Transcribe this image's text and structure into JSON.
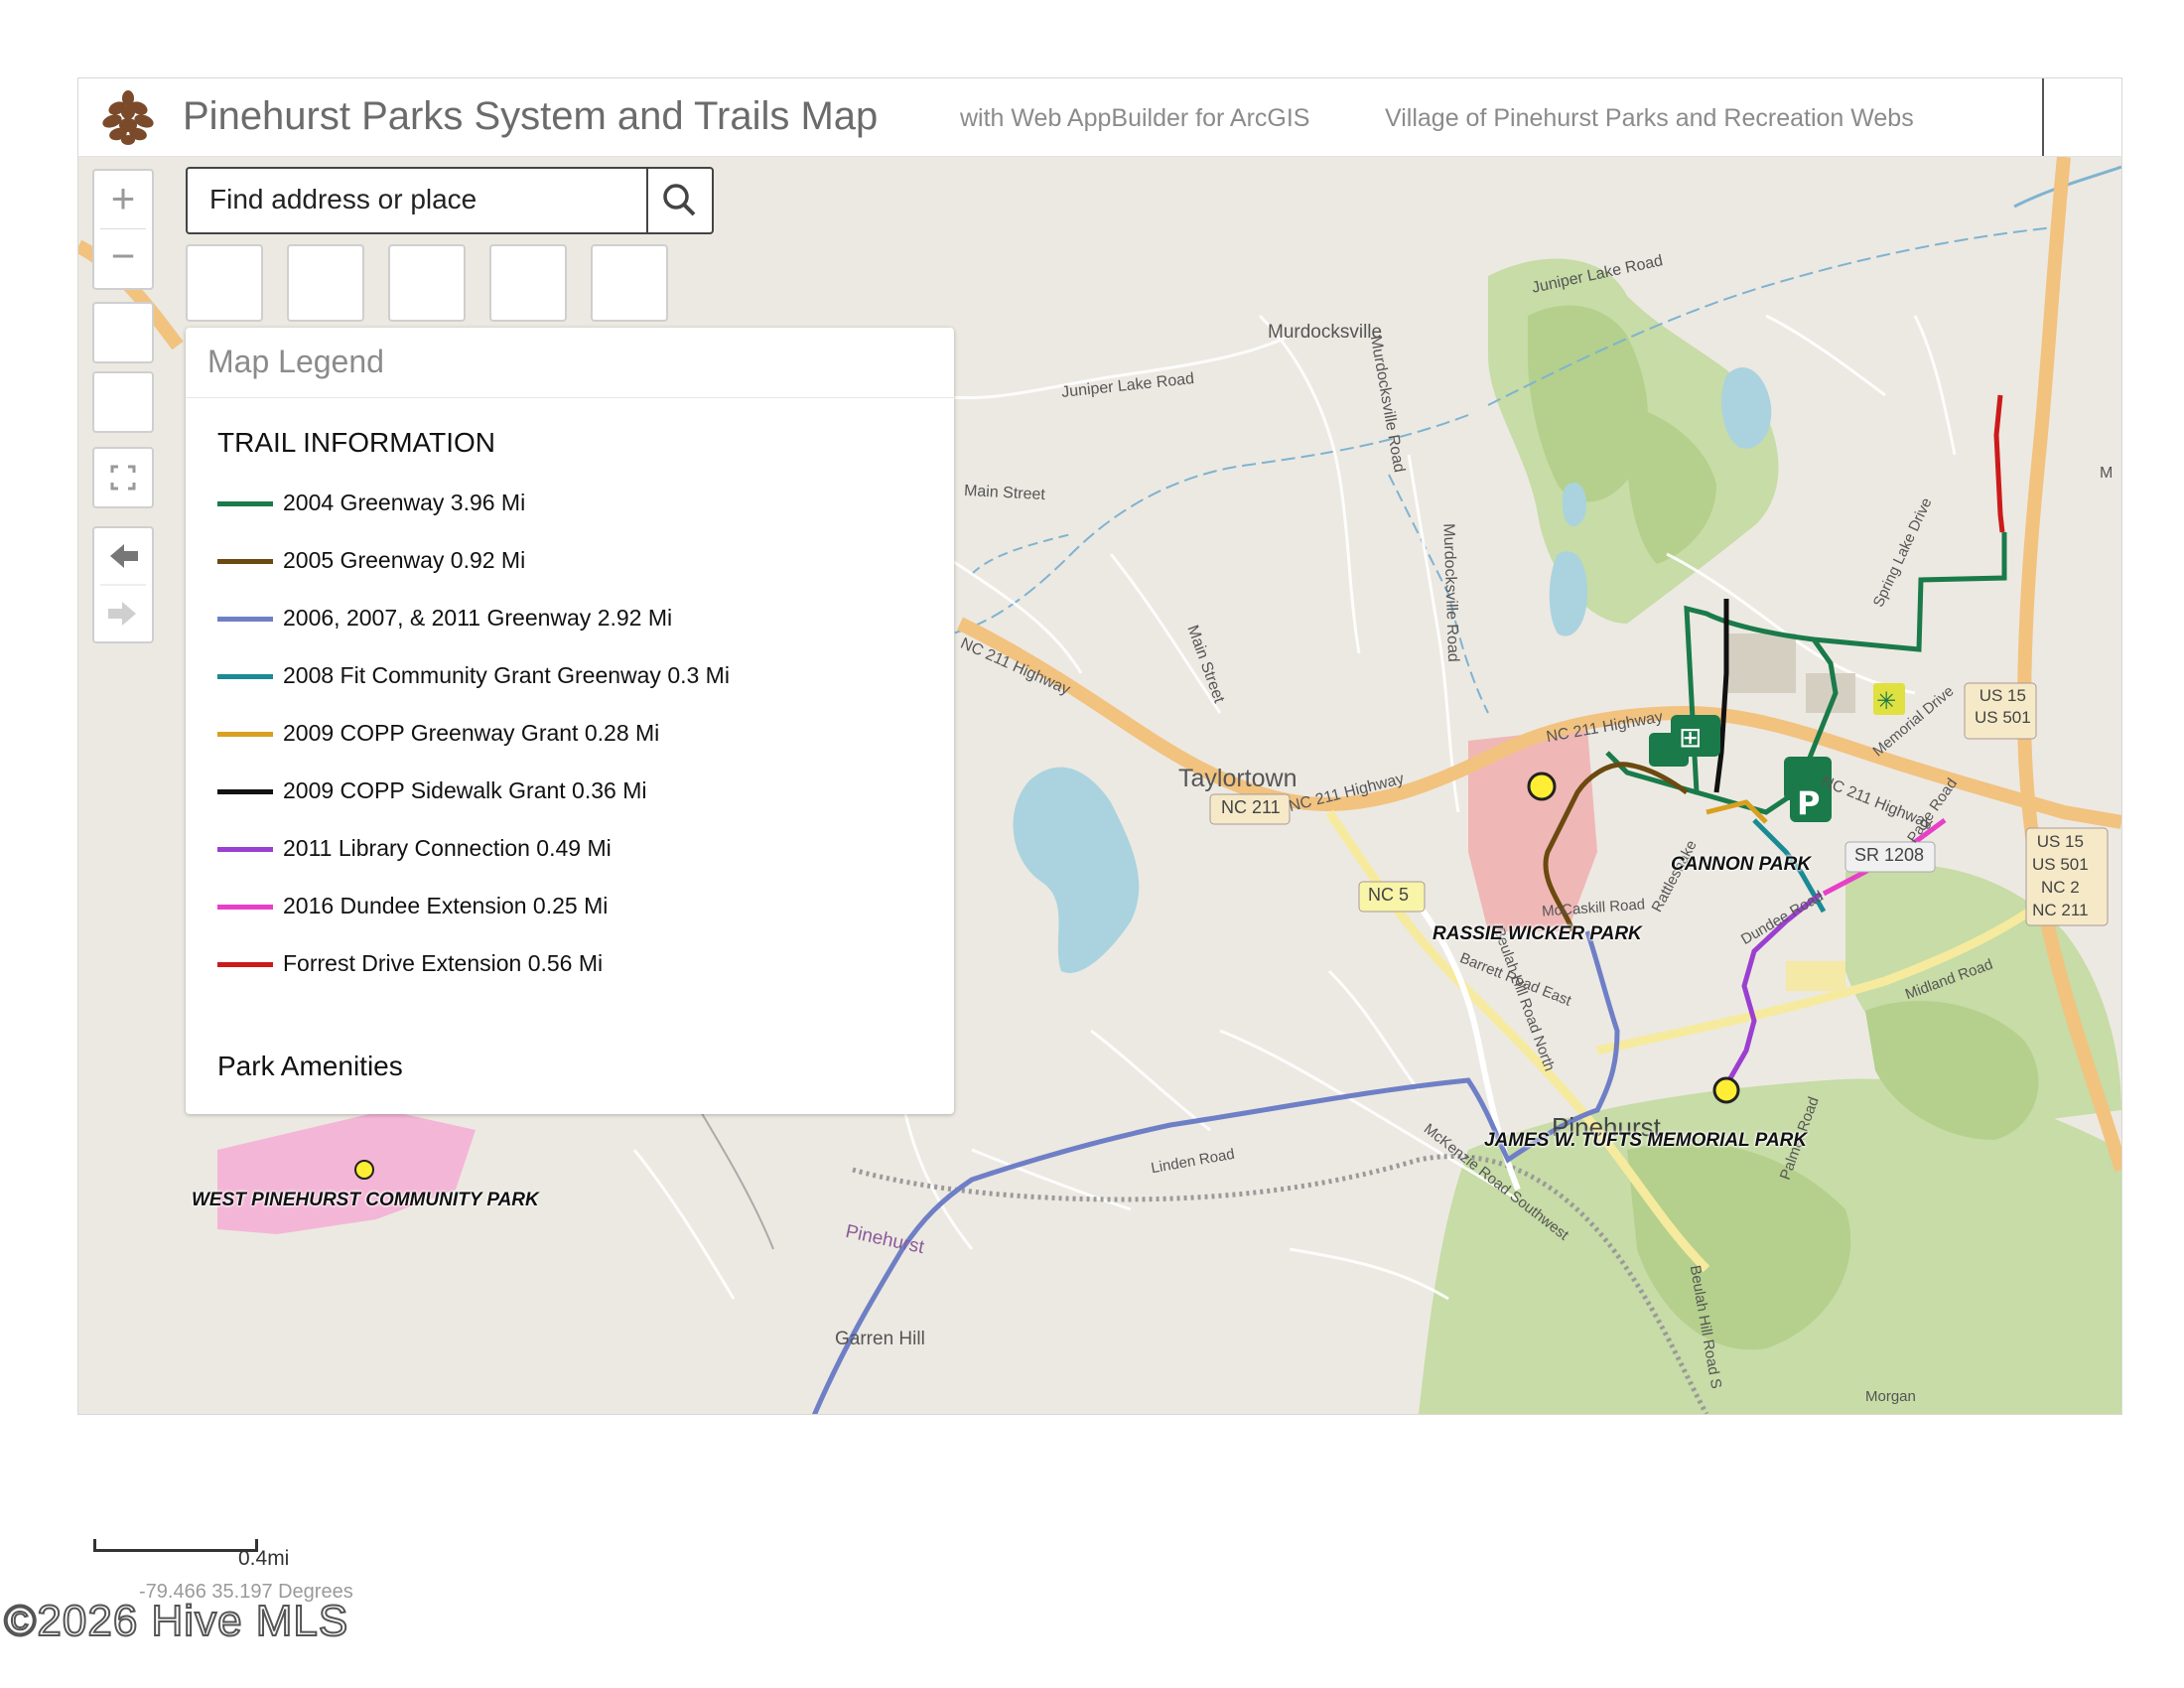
{
  "header": {
    "title": "Pinehurst Parks System and Trails Map",
    "builder_link": "with Web AppBuilder for ArcGIS",
    "parks_link": "Village of Pinehurst Parks and Recreation Webs",
    "logo_icon": "pinecone-icon"
  },
  "search": {
    "placeholder": "Find address or place",
    "icon": "search-icon"
  },
  "legend": {
    "title": "Map Legend",
    "trail_heading": "TRAIL INFORMATION",
    "amenities_heading": "Park Amenities",
    "trails": [
      {
        "label": "2004 Greenway 3.96 Mi",
        "color": "#1a7a4a"
      },
      {
        "label": "2005 Greenway 0.92 Mi",
        "color": "#6b4a10"
      },
      {
        "label": "2006, 2007, & 2011 Greenway 2.92 Mi",
        "color": "#6f7fc6"
      },
      {
        "label": "2008 Fit Community Grant Greenway 0.3 Mi",
        "color": "#1a8a95"
      },
      {
        "label": "2009 COPP Greenway Grant 0.28 Mi",
        "color": "#d9a020"
      },
      {
        "label": "2009 COPP Sidewalk Grant 0.36 Mi",
        "color": "#111111"
      },
      {
        "label": "2011 Library Connection 0.49 Mi",
        "color": "#9b3fd1"
      },
      {
        "label": "2016 Dundee Extension 0.25 Mi",
        "color": "#e83fc8"
      },
      {
        "label": "Forrest Drive Extension 0.56 Mi",
        "color": "#cc1a1a"
      }
    ]
  },
  "map": {
    "parks": {
      "cannon": "CANNON PARK",
      "rassie": "RASSIE WICKER PARK",
      "tufts": "JAMES W. TUFTS MEMORIAL PARK",
      "west": "WEST PINEHURST COMMUNITY PARK"
    },
    "places": {
      "murdocksville": "Murdocksville",
      "taylortown": "Taylortown",
      "pinehurst": "Pinehurst",
      "garren_hill": "Garren Hill",
      "pinehurst_small": "Pinehurst"
    },
    "roads": {
      "juniper_lake": "Juniper Lake Road",
      "juniper_lake2": "Juniper Lake Road",
      "main_street": "Main Street",
      "main_street2": "Main Street",
      "murdocksville_rd": "Murdocksville Road",
      "murdocksville_rd2": "Murdocksville Road",
      "nc211_hwy": "NC 211 Highway",
      "nc211_hwy2": "NC 211 Highway",
      "nc211_hwy3": "NC 211 Highway",
      "nc211_hwy4": "NC 211 Highway",
      "nc211_badge": "NC 211",
      "nc5_badge": "NC 5",
      "sr1208_badge": "SR 1208",
      "us15_us501": "US 15\nUS 501",
      "us15_us501_nc2_nc211": "US 15\nUS 501\nNC 2\nNC 211",
      "mccaskill": "McCaskill Road",
      "barrett": "Barrett Road East",
      "beulah": "Beulah Hill Road North",
      "beulah_s": "Beulah Hill Road S",
      "mckenzie": "McKenzie Road Southwest",
      "linden": "Linden Road",
      "rattlesnake": "Rattlesnake",
      "dundee": "Dundee Road",
      "memorial": "Memorial Drive",
      "page": "Page Road",
      "spring_lake": "Spring Lake Drive",
      "midland": "Midland Road",
      "palmer": "Palmer Road",
      "morgan": "Morgan",
      "m_edge": "M"
    }
  },
  "scale": {
    "label": "0.4mi"
  },
  "coords": {
    "label": "-79.466 35.197 Degrees"
  },
  "watermark": {
    "label": "©2026 Hive MLS"
  }
}
